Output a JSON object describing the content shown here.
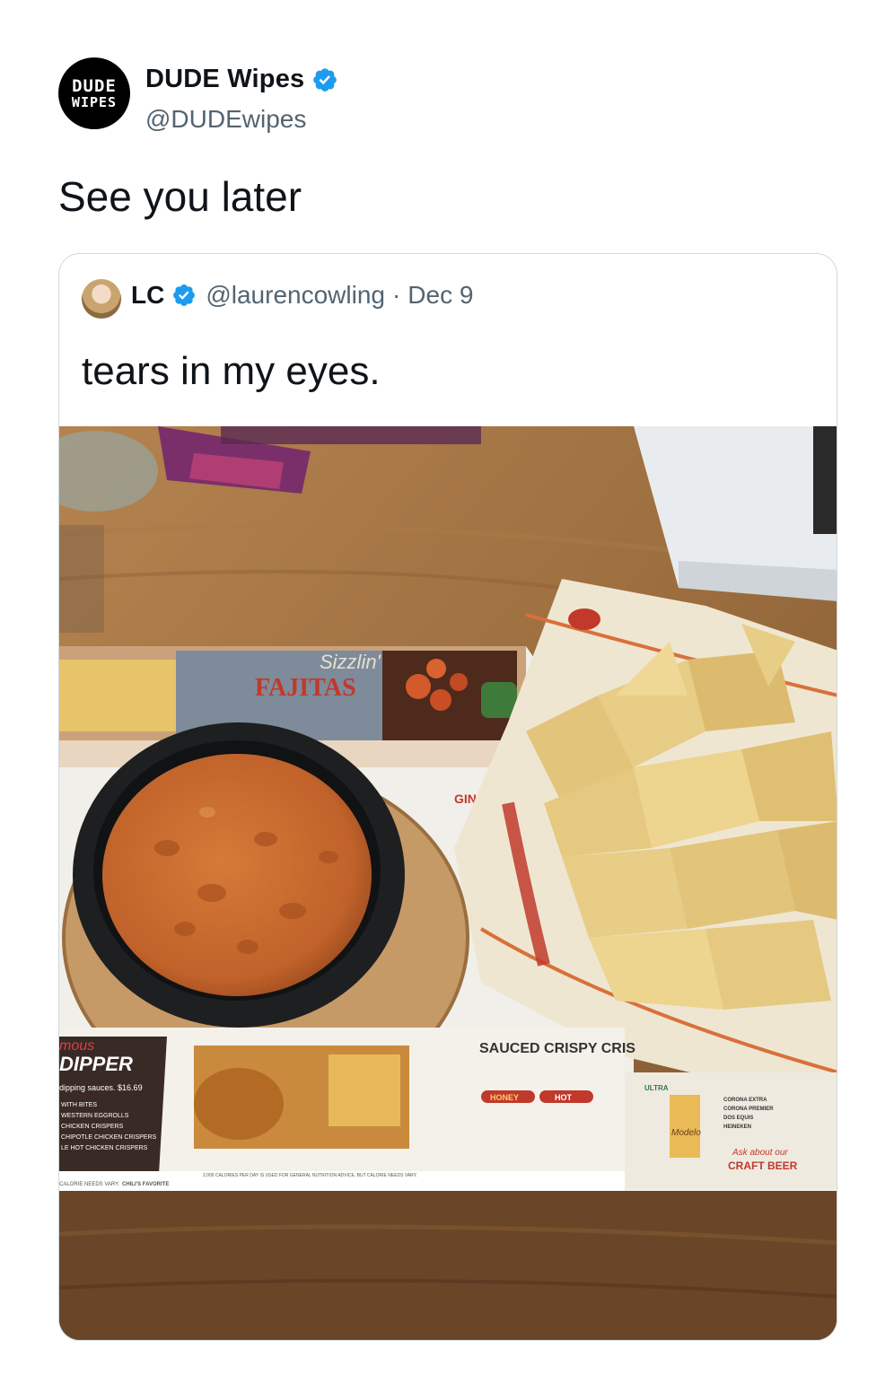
{
  "tweet": {
    "author": {
      "name": "DUDE Wipes",
      "handle": "@DUDEwipes",
      "avatar_logo": {
        "line1": "DUDE",
        "line2": "WIPES"
      },
      "verified_icon": "verified-badge-icon"
    },
    "text": "See you later"
  },
  "quoted_tweet": {
    "author": {
      "name": "LC",
      "handle": "@laurencowling",
      "verified_icon": "verified-badge-icon"
    },
    "separator": "·",
    "date": "Dec 9",
    "text": "tears in my eyes.",
    "photo": {
      "menu_texts": {
        "fajitas_script": "Sizzlin'",
        "fajitas": "FAJITAS",
        "dipper_famous": "mous",
        "dipper": "DIPPER",
        "dipper_price": "dipping sauces. $16.69",
        "dipper_items": [
          "WITH BITES",
          "WESTERN EGGROLLS",
          "CHICKEN CRISPERS",
          "CHIPOTLE CHICKEN CRISPERS",
          "LE HOT CHICKEN CRISPERS"
        ],
        "sauced": "SAUCED CRISPY CRIS",
        "honey": "HONEY",
        "hot": "HOT",
        "modelo": "Modelo",
        "ultra": "ULTRA",
        "beers": [
          "CORONA EXTRA",
          "CORONA PREMIER",
          "DOS EQUIS",
          "HEINEKEN"
        ],
        "craft_ask": "Ask about our",
        "craft": "CRAFT BEER",
        "footer_left": "CALORIE NEEDS VARY.",
        "footer_fav": "CHILI'S FAVORITE",
        "footer_mid": "2,000 CALORIES PER DAY IS USED FOR GENERAL NUTRITION ADVICE, BUT CALORIE NEEDS VARY.",
        "original": "GINAL T"
      },
      "colors": {
        "table": "#9b6d3e",
        "queso": "#c8692c",
        "chip": "#e2c47a",
        "bowl": "#1e1f21",
        "menu_red": "#b02e2e",
        "napkin": "#e9ecee"
      }
    }
  }
}
